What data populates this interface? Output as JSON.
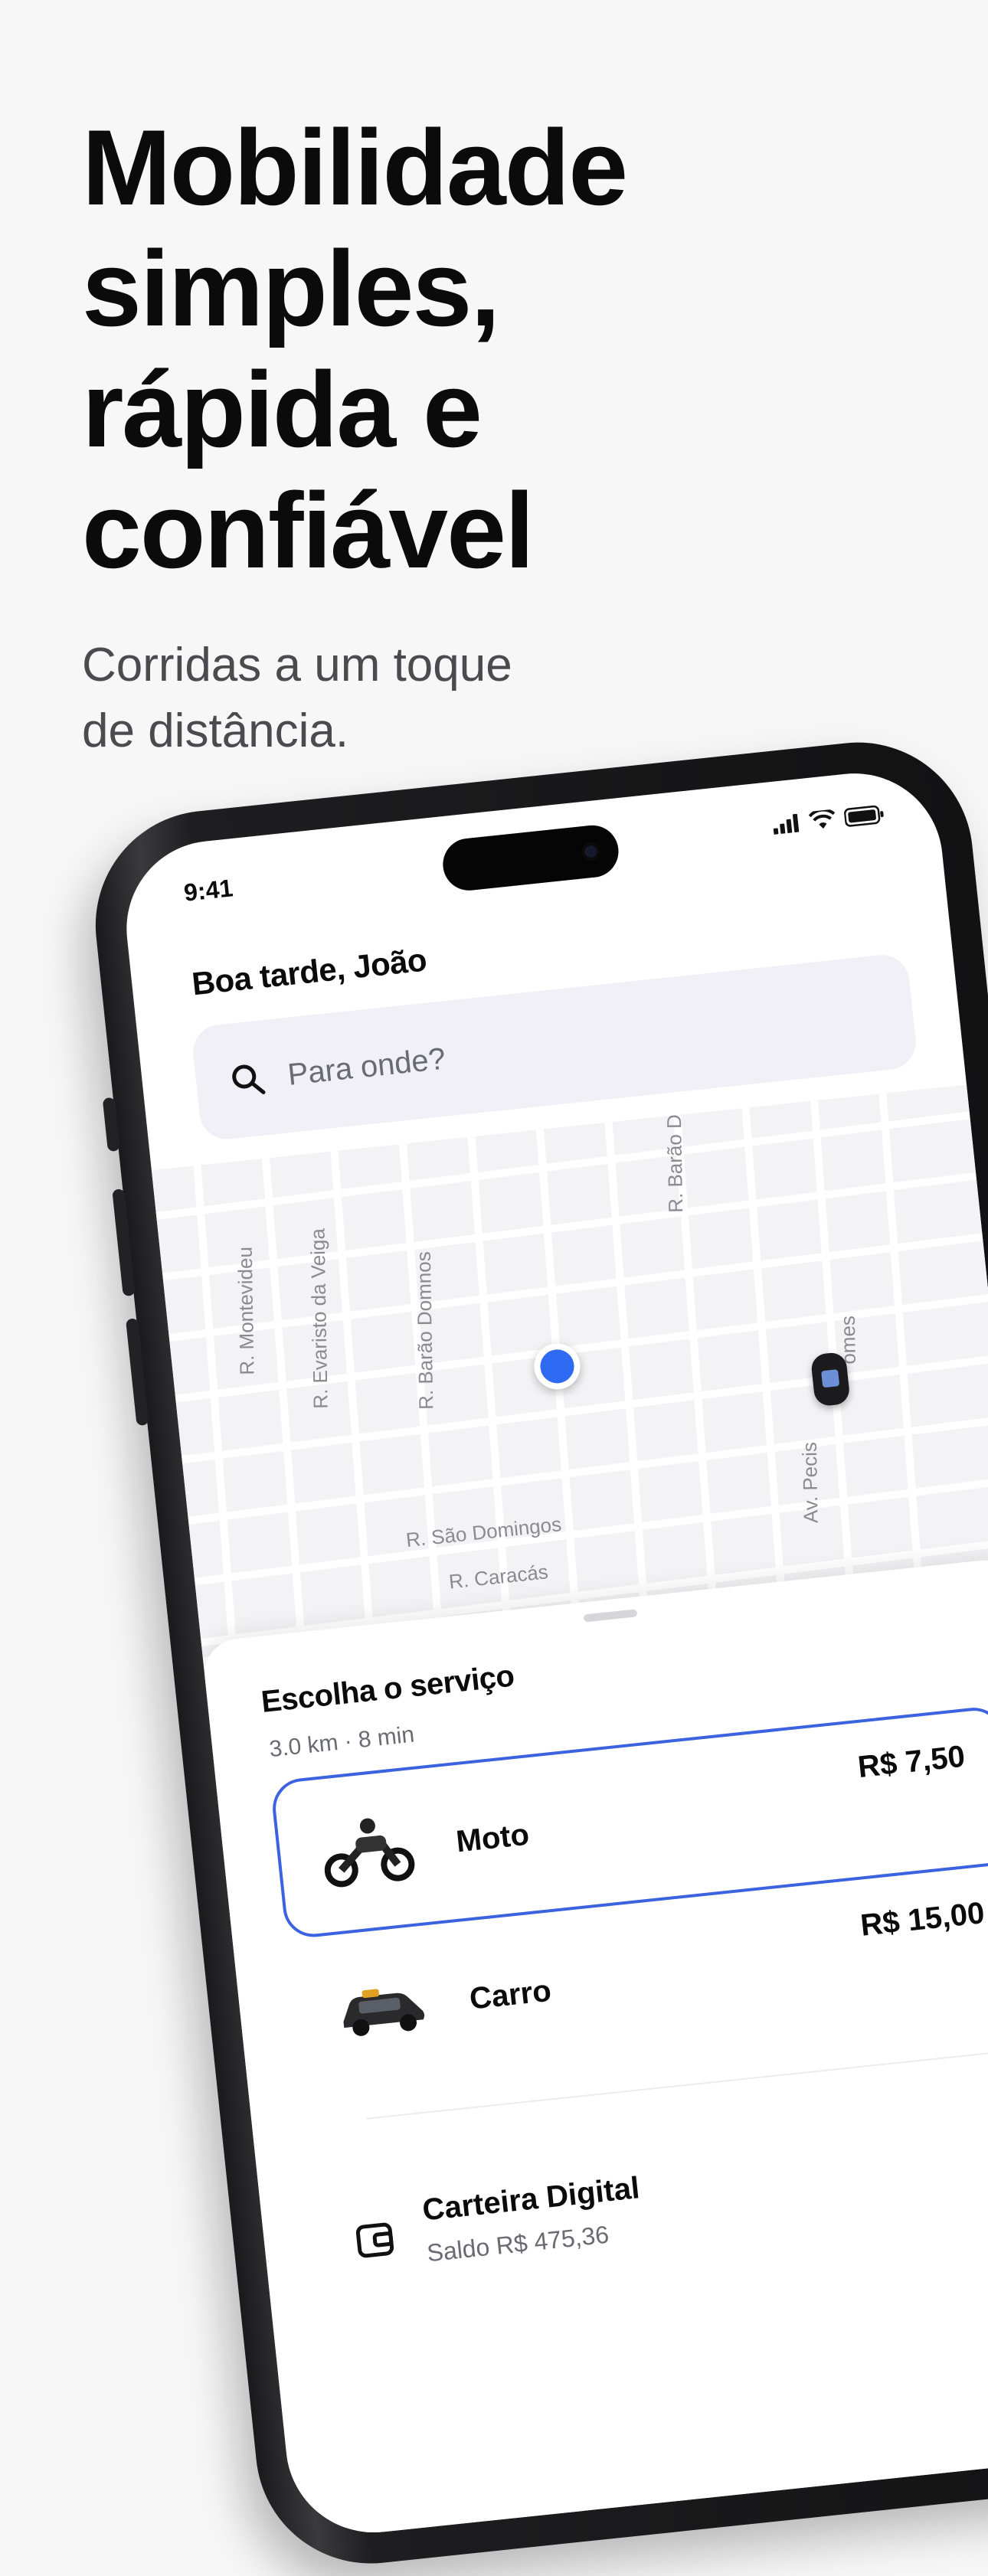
{
  "hero": {
    "title_lines": [
      "Mobilidade",
      "simples,",
      "rápida e",
      "confiável"
    ],
    "subtitle_lines": [
      "Corridas a um toque",
      "de distância."
    ]
  },
  "status_bar": {
    "time": "9:41",
    "icons": [
      "signal-icon",
      "wifi-icon",
      "battery-icon"
    ]
  },
  "app": {
    "greeting": "Boa tarde, João",
    "search": {
      "placeholder": "Para onde?",
      "icon": "search-icon"
    },
    "map": {
      "street_labels": [
        "R. Montevideu",
        "R. Evaristo da Veiga",
        "R. Barão Domnos",
        "R. Barão Da",
        "Av. Pecis",
        "omes",
        "R. São Domingos",
        "R. Caracás"
      ],
      "user_location_color": "#2f6bf2"
    },
    "sheet": {
      "title": "Escolha o serviço",
      "trip_info": "3.0 km · 8 min",
      "services": [
        {
          "name": "Moto",
          "price": "R$ 7,50",
          "selected": true,
          "icon": "motorcycle-icon"
        },
        {
          "name": "Carro",
          "price": "R$ 15,00",
          "selected": false,
          "icon": "car-icon"
        }
      ],
      "wallet": {
        "title": "Carteira Digital",
        "balance": "Saldo R$ 475,36",
        "icon": "wallet-icon"
      }
    }
  },
  "colors": {
    "accent": "#3b63e0",
    "search_bg": "#f1f0f7",
    "background": "#f7f7f8"
  }
}
